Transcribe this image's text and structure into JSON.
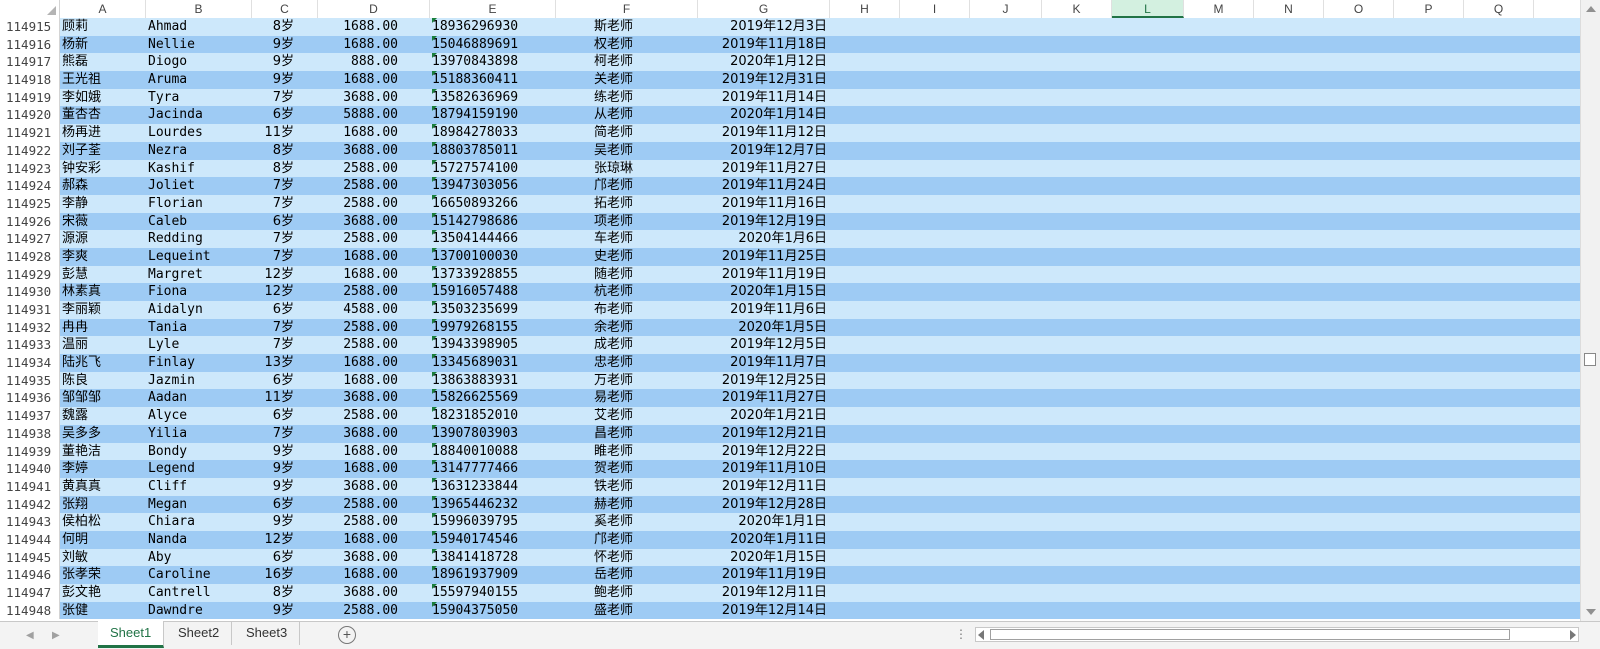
{
  "columns": [
    "A",
    "B",
    "C",
    "D",
    "E",
    "F",
    "G",
    "H",
    "I",
    "J",
    "K",
    "L",
    "M",
    "N",
    "O",
    "P",
    "Q"
  ],
  "selected_column": "L",
  "rows": [
    {
      "n": "114915",
      "a": "顾莉",
      "b": "Ahmad",
      "c": "8岁",
      "d": "1688.00",
      "e": "18936296930",
      "f": "斯老师",
      "g": "2019年12月3日"
    },
    {
      "n": "114916",
      "a": "杨新",
      "b": "Nellie",
      "c": "9岁",
      "d": "1688.00",
      "e": "15046889691",
      "f": "权老师",
      "g": "2019年11月18日"
    },
    {
      "n": "114917",
      "a": "熊磊",
      "b": "Diogo",
      "c": "9岁",
      "d": "888.00",
      "e": "13970843898",
      "f": "柯老师",
      "g": "2020年1月12日"
    },
    {
      "n": "114918",
      "a": "王光祖",
      "b": "Aruma",
      "c": "9岁",
      "d": "1688.00",
      "e": "15188360411",
      "f": "关老师",
      "g": "2019年12月31日"
    },
    {
      "n": "114919",
      "a": "李如娥",
      "b": "Tyra",
      "c": "7岁",
      "d": "3688.00",
      "e": "13582636969",
      "f": "练老师",
      "g": "2019年11月14日"
    },
    {
      "n": "114920",
      "a": "董杏杏",
      "b": "Jacinda",
      "c": "6岁",
      "d": "5888.00",
      "e": "18794159190",
      "f": "从老师",
      "g": "2020年1月14日"
    },
    {
      "n": "114921",
      "a": "杨再进",
      "b": "Lourdes",
      "c": "11岁",
      "d": "1688.00",
      "e": "18984278033",
      "f": "简老师",
      "g": "2019年11月12日"
    },
    {
      "n": "114922",
      "a": "刘子荃",
      "b": "Nezra",
      "c": "8岁",
      "d": "3688.00",
      "e": "18803785011",
      "f": "吴老师",
      "g": "2019年12月7日"
    },
    {
      "n": "114923",
      "a": "钟安彩",
      "b": "Kashif",
      "c": "8岁",
      "d": "2588.00",
      "e": "15727574100",
      "f": "张琼琳",
      "g": "2019年11月27日"
    },
    {
      "n": "114924",
      "a": "郝森",
      "b": "Joliet",
      "c": "7岁",
      "d": "2588.00",
      "e": "13947303056",
      "f": "邝老师",
      "g": "2019年11月24日"
    },
    {
      "n": "114925",
      "a": "李静",
      "b": "Florian",
      "c": "7岁",
      "d": "2588.00",
      "e": "16650893266",
      "f": "拓老师",
      "g": "2019年11月16日"
    },
    {
      "n": "114926",
      "a": "宋薇",
      "b": "Caleb",
      "c": "6岁",
      "d": "3688.00",
      "e": "15142798686",
      "f": "项老师",
      "g": "2019年12月19日"
    },
    {
      "n": "114927",
      "a": "源源",
      "b": "Redding",
      "c": "7岁",
      "d": "2588.00",
      "e": "13504144466",
      "f": "车老师",
      "g": "2020年1月6日"
    },
    {
      "n": "114928",
      "a": "李爽",
      "b": "Lequeint",
      "c": "7岁",
      "d": "1688.00",
      "e": "13700100030",
      "f": "史老师",
      "g": "2019年11月25日"
    },
    {
      "n": "114929",
      "a": "彭慧",
      "b": "Margret",
      "c": "12岁",
      "d": "1688.00",
      "e": "13733928855",
      "f": "随老师",
      "g": "2019年11月19日"
    },
    {
      "n": "114930",
      "a": "林素真",
      "b": "Fiona",
      "c": "12岁",
      "d": "2588.00",
      "e": "15916057488",
      "f": "杭老师",
      "g": "2020年1月15日"
    },
    {
      "n": "114931",
      "a": "李丽颖",
      "b": "Aidalyn",
      "c": "6岁",
      "d": "4588.00",
      "e": "13503235699",
      "f": "布老师",
      "g": "2019年11月6日"
    },
    {
      "n": "114932",
      "a": "冉冉",
      "b": "Tania",
      "c": "7岁",
      "d": "2588.00",
      "e": "19979268155",
      "f": "余老师",
      "g": "2020年1月5日"
    },
    {
      "n": "114933",
      "a": "温丽",
      "b": "Lyle",
      "c": "7岁",
      "d": "2588.00",
      "e": "13943398905",
      "f": "成老师",
      "g": "2019年12月5日"
    },
    {
      "n": "114934",
      "a": "陆兆飞",
      "b": "Finlay",
      "c": "13岁",
      "d": "1688.00",
      "e": "13345689031",
      "f": "忠老师",
      "g": "2019年11月7日"
    },
    {
      "n": "114935",
      "a": "陈良",
      "b": "Jazmin",
      "c": "6岁",
      "d": "1688.00",
      "e": "13863883931",
      "f": "万老师",
      "g": "2019年12月25日"
    },
    {
      "n": "114936",
      "a": "邹邹邹",
      "b": "Aadan",
      "c": "11岁",
      "d": "3688.00",
      "e": "15826625569",
      "f": "易老师",
      "g": "2019年11月27日"
    },
    {
      "n": "114937",
      "a": "魏露",
      "b": "Alyce",
      "c": "6岁",
      "d": "2588.00",
      "e": "18231852010",
      "f": "艾老师",
      "g": "2020年1月21日"
    },
    {
      "n": "114938",
      "a": "吴多多",
      "b": "Yilia",
      "c": "7岁",
      "d": "3688.00",
      "e": "13907803903",
      "f": "昌老师",
      "g": "2019年12月21日"
    },
    {
      "n": "114939",
      "a": "董艳洁",
      "b": "Bondy",
      "c": "9岁",
      "d": "1688.00",
      "e": "18840010088",
      "f": "睢老师",
      "g": "2019年12月22日"
    },
    {
      "n": "114940",
      "a": "李婷",
      "b": "Legend",
      "c": "9岁",
      "d": "1688.00",
      "e": "13147777466",
      "f": "贺老师",
      "g": "2019年11月10日"
    },
    {
      "n": "114941",
      "a": "黄真真",
      "b": "Cliff",
      "c": "9岁",
      "d": "3688.00",
      "e": "13631233844",
      "f": "铁老师",
      "g": "2019年12月11日"
    },
    {
      "n": "114942",
      "a": "张翔",
      "b": "Megan",
      "c": "6岁",
      "d": "2588.00",
      "e": "13965446232",
      "f": "赫老师",
      "g": "2019年12月28日"
    },
    {
      "n": "114943",
      "a": "侯柏松",
      "b": "Chiara",
      "c": "9岁",
      "d": "2588.00",
      "e": "15996039795",
      "f": "奚老师",
      "g": "2020年1月1日"
    },
    {
      "n": "114944",
      "a": "何明",
      "b": "Nanda",
      "c": "12岁",
      "d": "1688.00",
      "e": "15940174546",
      "f": "邝老师",
      "g": "2020年1月11日"
    },
    {
      "n": "114945",
      "a": "刘敏",
      "b": "Aby",
      "c": "6岁",
      "d": "3688.00",
      "e": "13841418728",
      "f": "怀老师",
      "g": "2020年1月15日"
    },
    {
      "n": "114946",
      "a": "张孝荣",
      "b": "Caroline",
      "c": "16岁",
      "d": "1688.00",
      "e": "18961937909",
      "f": "岳老师",
      "g": "2019年11月19日"
    },
    {
      "n": "114947",
      "a": "彭文艳",
      "b": "Cantrell",
      "c": "8岁",
      "d": "3688.00",
      "e": "15597940155",
      "f": "鲍老师",
      "g": "2019年12月11日"
    },
    {
      "n": "114948",
      "a": "张健",
      "b": "Dawndre",
      "c": "9岁",
      "d": "2588.00",
      "e": "15904375050",
      "f": "盛老师",
      "g": "2019年12月14日"
    }
  ],
  "sheets": [
    "Sheet1",
    "Sheet2",
    "Sheet3"
  ],
  "active_sheet": "Sheet1",
  "add_sheet_label": "+",
  "more_options_label": "⋮",
  "colors": {
    "row_light": "#cde8fb",
    "row_dark": "#9ecbf4",
    "accent": "#217346"
  }
}
